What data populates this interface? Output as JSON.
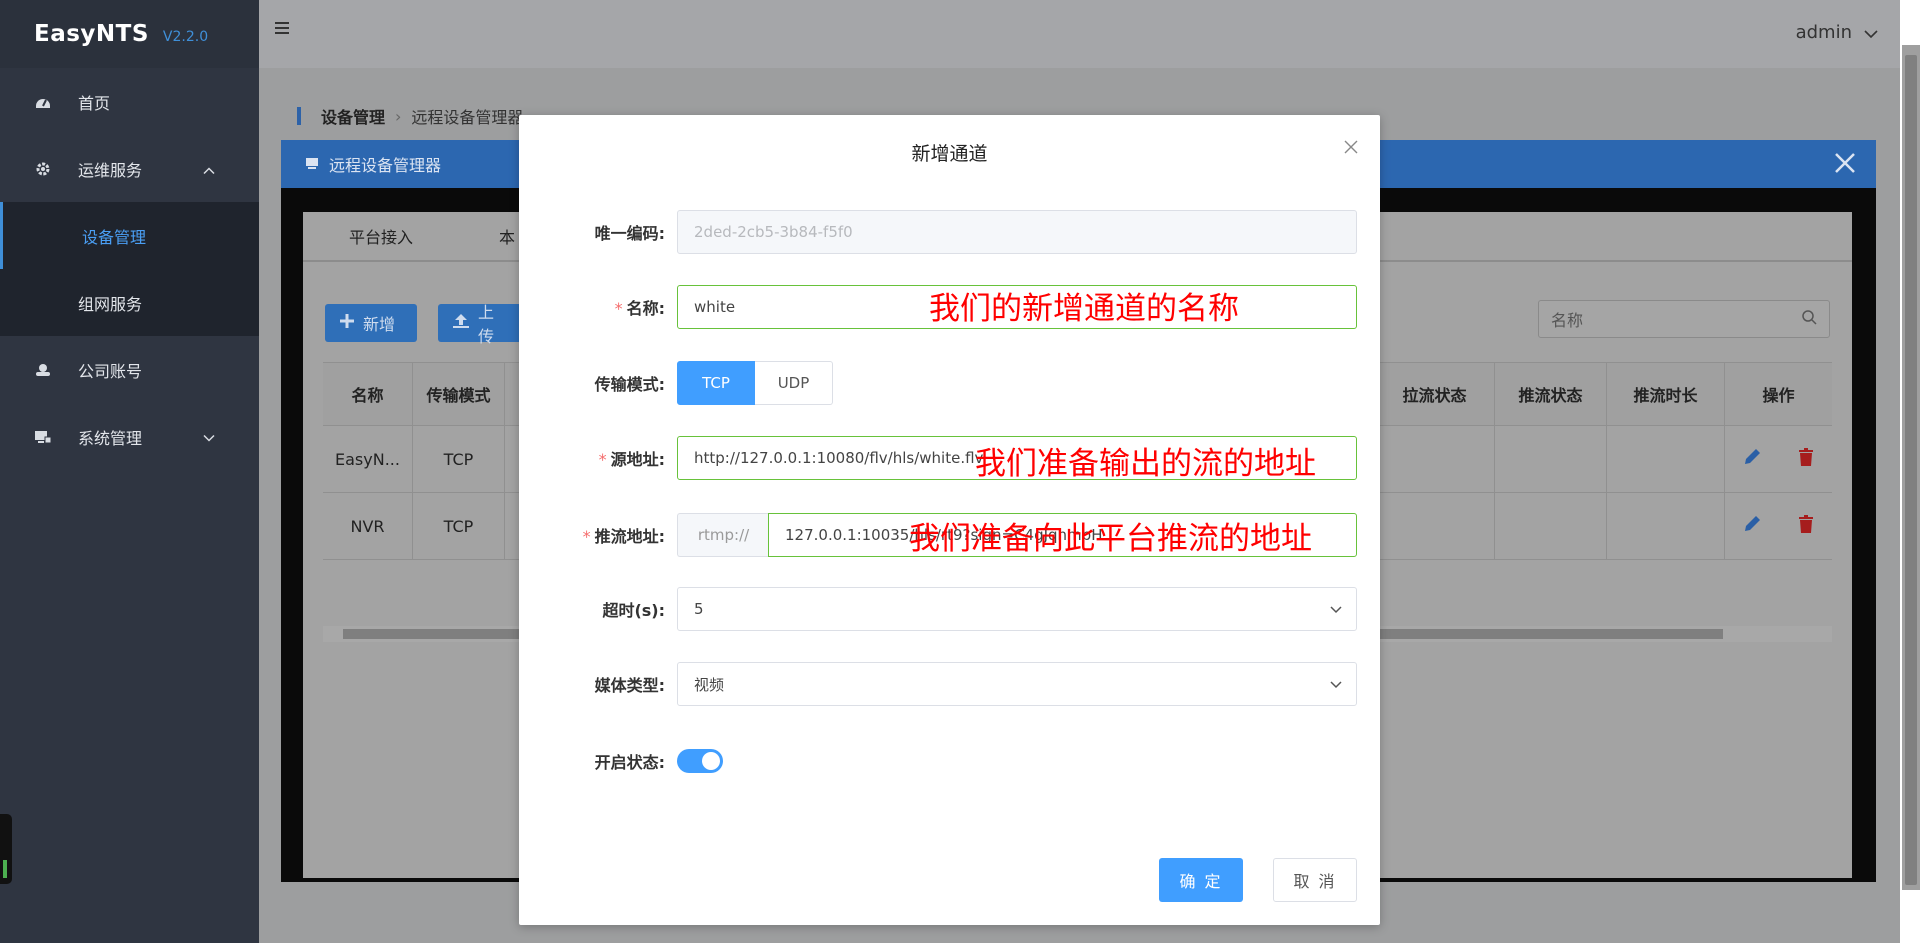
{
  "brand": {
    "name": "EasyNTS",
    "version": "V2.2.0"
  },
  "sidebar": {
    "items": [
      {
        "label": "首页",
        "icon": "dashboard-icon"
      },
      {
        "label": "运维服务",
        "icon": "gear-icon",
        "expanded": true
      },
      {
        "label": "设备管理",
        "sub": true,
        "active": true
      },
      {
        "label": "组网服务",
        "sub": true
      },
      {
        "label": "公司账号",
        "icon": "user-icon"
      },
      {
        "label": "系统管理",
        "icon": "monitor-icon",
        "expanded": false
      }
    ]
  },
  "header": {
    "user": "admin"
  },
  "breadcrumb": {
    "level1": "设备管理",
    "level2": "远程设备管理器"
  },
  "inner_window": {
    "title": "远程设备管理器"
  },
  "tabs": [
    "平台接入",
    "本"
  ],
  "toolbar": {
    "add_label": "新增",
    "upload_label": "上传",
    "search_placeholder": "名称"
  },
  "table": {
    "headers_left": [
      "名称",
      "传输模式"
    ],
    "headers_right": [
      "拉流状态",
      "推流状态",
      "推流时长",
      "操作"
    ],
    "rows": [
      {
        "name": "EasyN...",
        "mode": "TCP"
      },
      {
        "name": "NVR",
        "mode": "TCP"
      }
    ]
  },
  "modal": {
    "title": "新增通道",
    "fields": {
      "uid_label": "唯一编码:",
      "uid_value": "2ded-2cb5-3b84-f5f0",
      "name_label": "名称:",
      "name_value": "white",
      "mode_label": "传输模式:",
      "mode_tcp": "TCP",
      "mode_udp": "UDP",
      "source_label": "源地址:",
      "source_value": "http://127.0.0.1:10080/flv/hls/white.flv",
      "push_label": "推流地址:",
      "push_prefix": "rtmp://",
      "push_value": "127.0.0.1:10035/hls/rt9?sign=C4gJqhmpH",
      "timeout_label": "超时(s):",
      "timeout_value": "5",
      "media_label": "媒体类型:",
      "media_value": "视频",
      "status_label": "开启状态:",
      "status_on": true
    },
    "ok_label": "确 定",
    "cancel_label": "取 消"
  },
  "annotations": {
    "name_note": "我们的新增通道的名称",
    "source_note": "我们准备输出的流的地址",
    "push_note": "我们准备向此平台推流的地址"
  },
  "colors": {
    "primary": "#409eff",
    "sidebar": "#2f3541",
    "annotation": "#ff0000",
    "valid": "#67c23a"
  }
}
